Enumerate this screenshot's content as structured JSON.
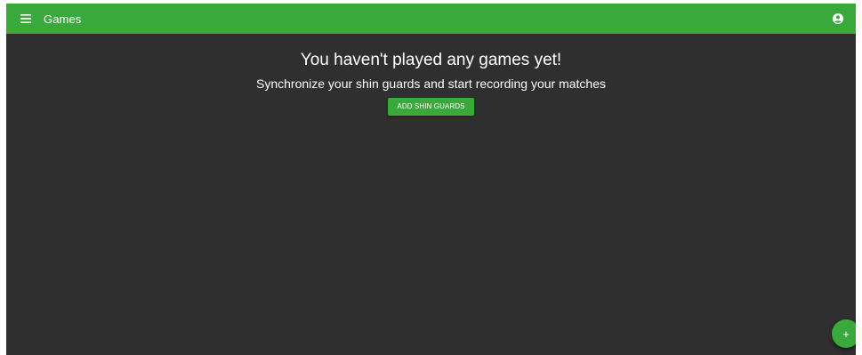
{
  "colors": {
    "accent": "#3aa93c",
    "background": "#2f2f2f",
    "text": "#ffffff"
  },
  "header": {
    "title": "Games",
    "menu_icon": "hamburger-menu-icon",
    "account_icon": "account-circle-icon"
  },
  "empty_state": {
    "title": "You haven't played any games yet!",
    "subtitle": "Synchronize your shin guards and start recording your matches",
    "button_label": "ADD SHIN GUARDS"
  },
  "fab": {
    "icon": "plus-icon",
    "label": "+"
  }
}
